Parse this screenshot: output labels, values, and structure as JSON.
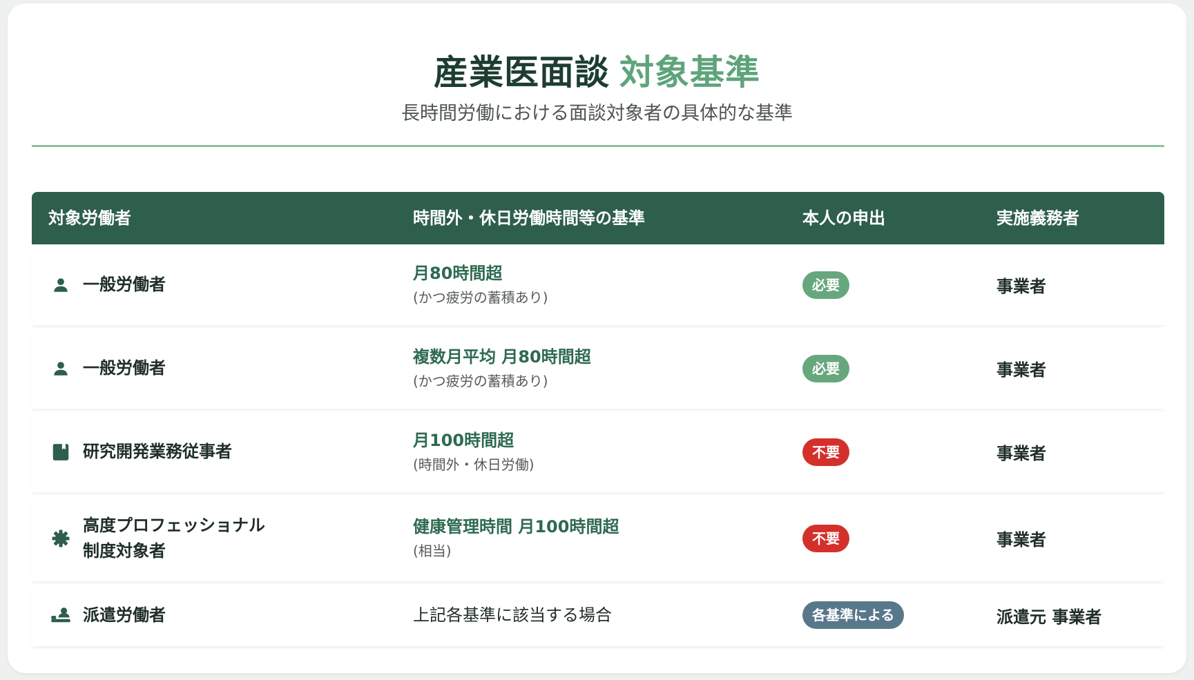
{
  "header": {
    "title_main": "産業医面談",
    "title_accent": "対象基準",
    "subtitle": "長時間労働における面談対象者の具体的な基準"
  },
  "table": {
    "columns": [
      "対象労働者",
      "時間外・休日労働時間等の基準",
      "本人の申出",
      "実施義務者"
    ],
    "rows": [
      {
        "icon": "person-icon",
        "worker": "一般労働者",
        "criterion": "月80時間超",
        "note": "(かつ疲労の蓄積あり)",
        "request": "必要",
        "obligor": "事業者"
      },
      {
        "icon": "person-icon",
        "worker": "一般労働者",
        "criterion": "複数月平均 月80時間超",
        "note": "(かつ疲労の蓄積あり)",
        "request": "必要",
        "obligor": "事業者"
      },
      {
        "icon": "research-notebook-icon",
        "worker": "研究開発業務従事者",
        "criterion": "月100時間超",
        "note": "(時間外・休日労働)",
        "request": "不要",
        "obligor": "事業者"
      },
      {
        "icon": "gear-icon",
        "worker_line1": "高度プロフェッショナル",
        "worker_line2": "制度対象者",
        "criterion": "健康管理時間 月100時間超",
        "note": "(相当)",
        "request": "不要",
        "obligor": "事業者"
      },
      {
        "icon": "dispatched-worker-icon",
        "worker": "派遣労働者",
        "criterion": "上記各基準に該当する場合",
        "request": "各基準による",
        "obligor": "派遣元 事業者"
      }
    ]
  },
  "colors": {
    "header_bg": "#2e5e4c",
    "accent": "#5ea47a",
    "badge_required": "#67a77e",
    "badge_not_required": "#d4302b",
    "badge_per_criterion": "#58778a"
  }
}
